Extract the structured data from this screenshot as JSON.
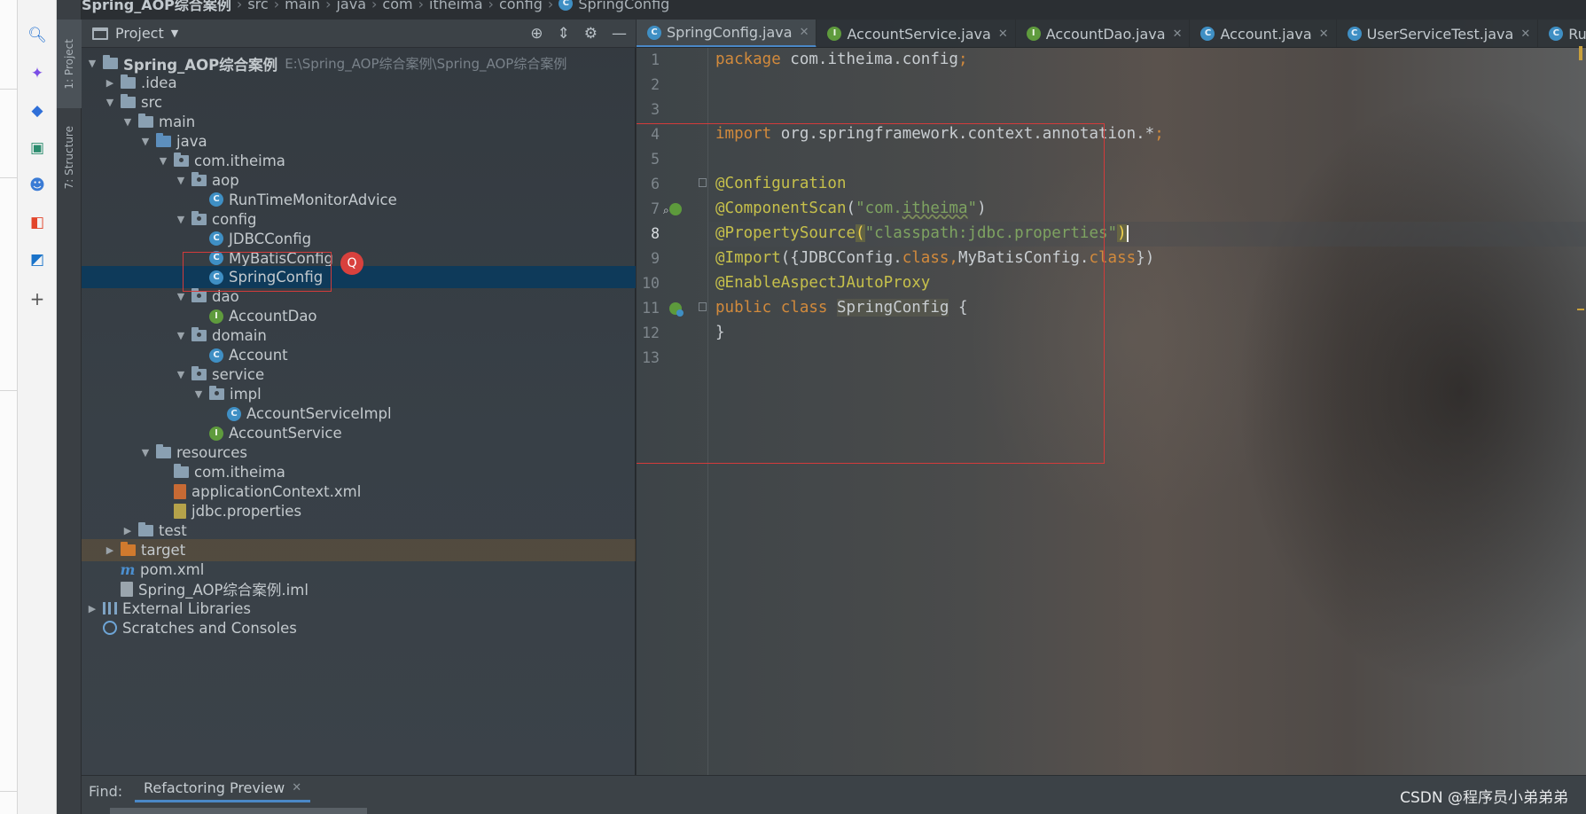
{
  "breadcrumb": [
    "Spring_AOP综合案例",
    "src",
    "main",
    "java",
    "com",
    "itheima",
    "config",
    "SpringConfig"
  ],
  "tool_strip": {
    "project_tab": "1: Project",
    "structure_tab": "7: Structure"
  },
  "project_panel": {
    "title": "Project"
  },
  "tree": [
    {
      "label": "Spring_AOP综合案例",
      "path": "E:\\Spring_AOP综合案例\\Spring_AOP综合案例",
      "indent": 0,
      "arrow": "down",
      "icon": "module-folder",
      "bold": true
    },
    {
      "label": ".idea",
      "indent": 1,
      "arrow": "right",
      "icon": "folder"
    },
    {
      "label": "src",
      "indent": 1,
      "arrow": "down",
      "icon": "folder"
    },
    {
      "label": "main",
      "indent": 2,
      "arrow": "down",
      "icon": "folder"
    },
    {
      "label": "java",
      "indent": 3,
      "arrow": "down",
      "icon": "source-folder"
    },
    {
      "label": "com.itheima",
      "indent": 4,
      "arrow": "down",
      "icon": "package"
    },
    {
      "label": "aop",
      "indent": 5,
      "arrow": "down",
      "icon": "package"
    },
    {
      "label": "RunTimeMonitorAdvice",
      "indent": 6,
      "icon": "class"
    },
    {
      "label": "config",
      "indent": 5,
      "arrow": "down",
      "icon": "package"
    },
    {
      "label": "JDBCConfig",
      "indent": 6,
      "icon": "class"
    },
    {
      "label": "MyBatisConfig",
      "indent": 6,
      "icon": "class"
    },
    {
      "label": "SpringConfig",
      "indent": 6,
      "icon": "class",
      "selected": true
    },
    {
      "label": "dao",
      "indent": 5,
      "arrow": "down",
      "icon": "package"
    },
    {
      "label": "AccountDao",
      "indent": 6,
      "icon": "interface"
    },
    {
      "label": "domain",
      "indent": 5,
      "arrow": "down",
      "icon": "package"
    },
    {
      "label": "Account",
      "indent": 6,
      "icon": "class"
    },
    {
      "label": "service",
      "indent": 5,
      "arrow": "down",
      "icon": "package"
    },
    {
      "label": "impl",
      "indent": 6,
      "arrow": "down",
      "icon": "package"
    },
    {
      "label": "AccountServiceImpl",
      "indent": 7,
      "icon": "class"
    },
    {
      "label": "AccountService",
      "indent": 6,
      "icon": "interface"
    },
    {
      "label": "resources",
      "indent": 3,
      "arrow": "down",
      "icon": "resource-folder"
    },
    {
      "label": "com.itheima",
      "indent": 4,
      "icon": "folder"
    },
    {
      "label": "applicationContext.xml",
      "indent": 4,
      "icon": "xml"
    },
    {
      "label": "jdbc.properties",
      "indent": 4,
      "icon": "properties"
    },
    {
      "label": "test",
      "indent": 2,
      "arrow": "right",
      "icon": "folder"
    },
    {
      "label": "target",
      "indent": 1,
      "arrow": "right",
      "icon": "excluded-folder",
      "highlight": true
    },
    {
      "label": "pom.xml",
      "indent": 1,
      "icon": "maven"
    },
    {
      "label": "Spring_AOP综合案例.iml",
      "indent": 1,
      "icon": "file"
    },
    {
      "label": "External Libraries",
      "indent": 0,
      "arrow": "right",
      "icon": "libraries"
    },
    {
      "label": "Scratches and Consoles",
      "indent": 0,
      "icon": "scratches"
    }
  ],
  "tabs": [
    {
      "label": "SpringConfig.java",
      "icon": "C",
      "kind": "class",
      "active": true,
      "closable": true
    },
    {
      "label": "AccountService.java",
      "icon": "I",
      "kind": "interface",
      "closable": true
    },
    {
      "label": "AccountDao.java",
      "icon": "I",
      "kind": "interface",
      "closable": true
    },
    {
      "label": "Account.java",
      "icon": "C",
      "kind": "class",
      "closable": true
    },
    {
      "label": "UserServiceTest.java",
      "icon": "C",
      "kind": "test",
      "closable": true
    },
    {
      "label": "RunTi",
      "icon": "C",
      "kind": "class",
      "closable": false
    }
  ],
  "editor": {
    "line_numbers": [
      "1",
      "2",
      "3",
      "4",
      "5",
      "6",
      "7",
      "8",
      "9",
      "10",
      "11",
      "12",
      "13"
    ],
    "current_line": "8",
    "code": {
      "l1_kw": "package",
      "l1_rest": " com.itheima.config",
      "l4_kw": "import",
      "l4_rest": " org.springframework.context.annotation.*",
      "l6_ann": "@Configuration",
      "l7_ann": "@ComponentScan",
      "l7_str_a": "\"com.",
      "l7_str_b": "itheima",
      "l7_str_c": "\"",
      "l8_ann": "@PropertySource",
      "l8_str": "\"classpath:jdbc.properties\"",
      "l9_ann": "@Import",
      "l9_open": "({JDBCConfig.",
      "l9_kw1": "class",
      "l9_mid": ",MyBatisConfig.",
      "l9_kw2": "class",
      "l9_close": "})",
      "l10_ann": "@EnableAspectJAutoProxy",
      "l11_kw": "public class",
      "l11_cls": "SpringConfig",
      "l11_rest": " {",
      "l12": "}"
    }
  },
  "find_bar": {
    "label": "Find:",
    "tab": "Refactoring Preview"
  },
  "watermark": "CSDN @程序员小弟弟弟",
  "colors": {
    "keyword": "#d28a3c",
    "annotation": "#c6c04b",
    "string": "#7ea361",
    "selection": "#0e3a5a",
    "annotation_box": "#d33b3b"
  }
}
